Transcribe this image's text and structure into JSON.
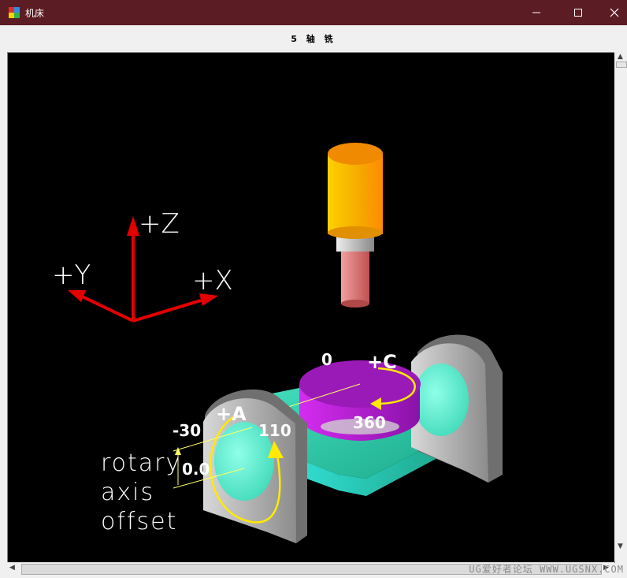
{
  "window": {
    "title": "机床",
    "icon": "app-grid-icon",
    "controls": [
      "minimize-icon",
      "maximize-icon",
      "close-icon"
    ]
  },
  "header": {
    "title": "5 轴 铣"
  },
  "scene": {
    "axis_labels": {
      "z": "+Z",
      "y": "+Y",
      "x": "+X"
    },
    "c_axis": {
      "label": "+C",
      "start": "0",
      "end": "360"
    },
    "a_axis": {
      "label": "+A",
      "min": "-30",
      "max": "110"
    },
    "offset_value": "0.0",
    "offset_caption": [
      "rotary",
      "axis",
      "offset"
    ]
  },
  "colors": {
    "title_bar": "#5b1c24",
    "tool_body": "#f5a800",
    "tool_spindle": "#d86a6a",
    "rotary_table": "#a61fc4",
    "bed": "#2fc7a0",
    "cradle": "#9a9a9a",
    "rotation_arrows": "#ffea00",
    "axis_arrows": "#e50000"
  },
  "watermark": "UG爱好者论坛 WWW.UGSNX.COM"
}
